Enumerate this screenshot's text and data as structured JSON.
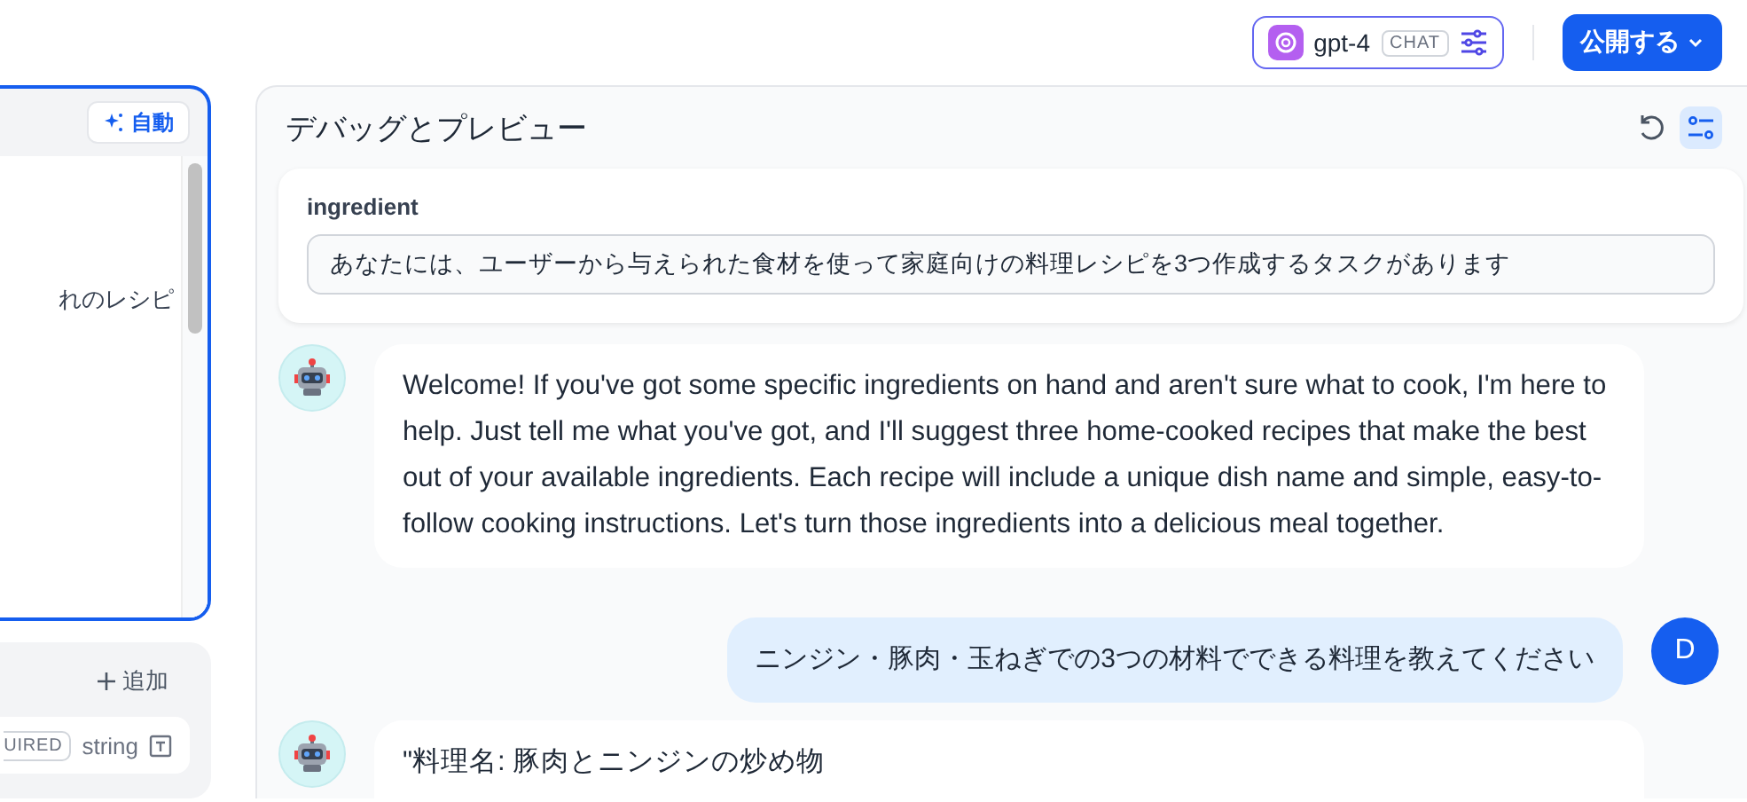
{
  "topbar": {
    "model": {
      "name": "gpt-4",
      "badge": "CHAT"
    },
    "publish_button": "公開する"
  },
  "prompt_panel": {
    "auto_button": "自動",
    "text_fragment": "れのレシピ"
  },
  "variables_panel": {
    "add_button": "追加",
    "variables": [
      {
        "required_badge": "UIRED",
        "type": "string"
      }
    ]
  },
  "preview": {
    "title": "デバッグとプレビュー",
    "settings_active": true,
    "inputs": [
      {
        "label": "ingredient",
        "value": "あなたには、ユーザーから与えられた食材を使って家庭向けの料理レシピを3つ作成するタスクがあります"
      }
    ],
    "messages": [
      {
        "kind": "assistant",
        "lines": [
          "Welcome! If you've got some specific ingredients on hand and aren't sure what to cook, I'm here to help. Just tell me what you've got, and I'll suggest three home-cooked recipes that make the best out of your available ingredients. Each recipe will include a unique dish name and simple, easy-to-follow cooking instructions. Let's turn those ingredients into a delicious meal together."
        ]
      },
      {
        "kind": "user",
        "avatar": "D",
        "lines": [
          "ニンジン・豚肉・玉ねぎでの3つの材料でできる料理を教えてください"
        ]
      },
      {
        "kind": "assistant",
        "lines": [
          "\"料理名: 豚肉とニンジンの炒め物"
        ]
      }
    ]
  }
}
